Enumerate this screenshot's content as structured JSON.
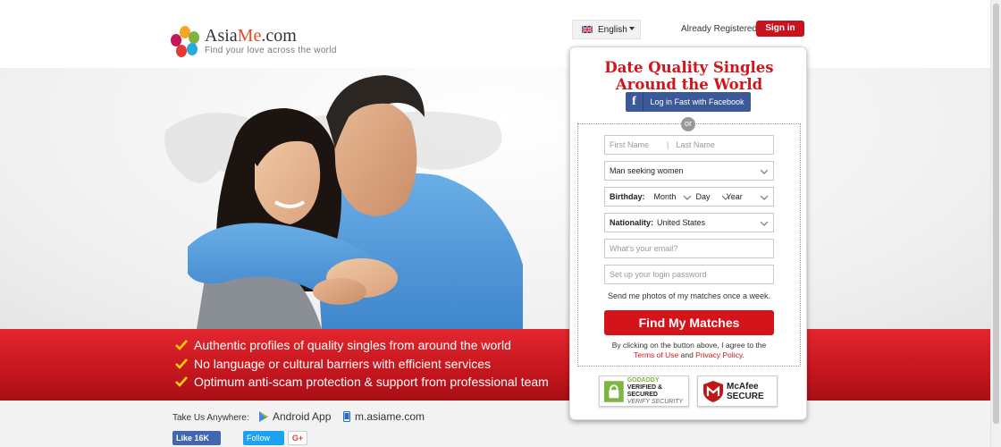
{
  "header": {
    "brand_prefix": "Asia",
    "brand_highlight": "Me",
    "brand_suffix": ".com",
    "tagline": "Find your love across the world",
    "language": "English",
    "already_registered": "Already Registered?",
    "sign_in": "Sign in"
  },
  "hero": {
    "bullets": [
      "Authentic profiles of quality singles from around the world",
      "No language or cultural barriers with efficient services",
      "Optimum anti-scam protection & support from professional team"
    ]
  },
  "signup": {
    "title_line1": "Date Quality Singles",
    "title_line2": "Around the World",
    "facebook_label": "Log in Fast with Facebook",
    "or": "or",
    "first_name_placeholder": "First Name",
    "last_name_placeholder": "Last Name",
    "seeking": "Man seeking women",
    "birthday_label": "Birthday:",
    "month": "Month",
    "day": "Day",
    "year": "Year",
    "nationality_label": "Nationality:",
    "nationality_value": "United States",
    "email_placeholder": "What's your email?",
    "password_placeholder": "Set up your login password",
    "send_photos": "Send me photos of my matches once a week.",
    "submit": "Find My Matches",
    "terms_prefix": "By clicking on the button above, I agree to the",
    "terms_link": "Terms of Use",
    "terms_and": "and",
    "privacy_link": "Privacy Policy",
    "terms_end": "."
  },
  "badges": {
    "godaddy_line1": "GODADDY",
    "godaddy_line2": "VERIFIED & SECURED",
    "godaddy_line3": "VERIFY SECURITY",
    "mcafee_line1": "McAfee",
    "mcafee_line2": "SECURE"
  },
  "footer": {
    "take_us": "Take Us Anywhere:",
    "android": "Android App",
    "mobile_site": "m.asiame.com",
    "like": "Like 16K",
    "follow": "Follow",
    "gplus": "G+"
  },
  "colors": {
    "brand_red": "#d3141b",
    "facebook_blue": "#3b5998",
    "twitter_blue": "#1da1f2"
  }
}
